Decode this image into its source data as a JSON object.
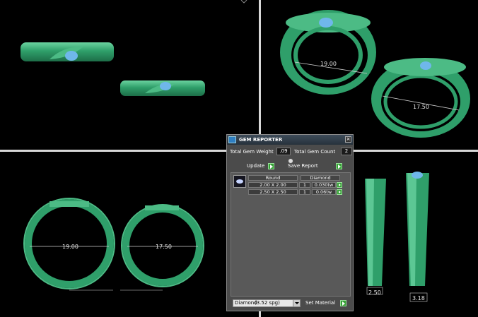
{
  "panel": {
    "title": "GEM REPORTER",
    "close_glyph": "×",
    "total_gem_weight_label": "Total Gem Weight",
    "total_gem_weight_value": ".09",
    "total_gem_count_label": "Total Gem Count",
    "total_gem_count_value": "2",
    "update_label": "Update",
    "save_report_label": "Save Report",
    "table_headers": {
      "shape": "Round",
      "material": "Diamond"
    },
    "gems": [
      {
        "size": "2.00 X 2.00",
        "qty": "1",
        "weight": "0.030tw"
      },
      {
        "size": "2.50 X 2.50",
        "qty": "1",
        "weight": "0.06tw"
      }
    ],
    "material_select": {
      "value": "Diamond",
      "gravity": "(3.52 spg)"
    },
    "set_material_label": "Set Material"
  },
  "dimensions": {
    "ring_large_diameter": "19.00",
    "ring_small_diameter": "17.50",
    "ring_large_width": "2.50",
    "ring_small_width": "3.18"
  },
  "colors": {
    "ring_green": "#2f9f6a",
    "ring_highlight": "#5cc794",
    "gem_blue": "#6fb7ea",
    "viewport_divider": "#d8d8d8",
    "accent_green_button": "#35a035"
  }
}
